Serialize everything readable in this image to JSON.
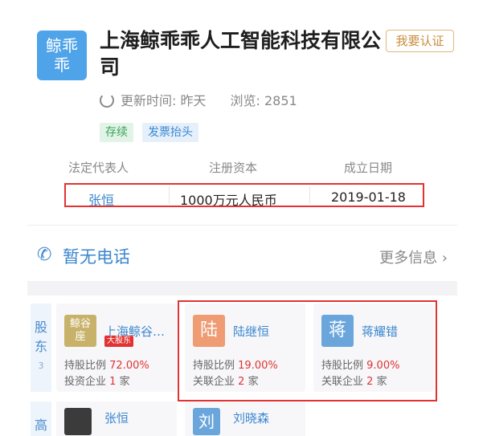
{
  "company": {
    "logo_line1": "鲸乖",
    "logo_line2": "乖",
    "name": "上海鲸乖乖人工智能科技有限公司",
    "claim_label": "我要认证",
    "updated": "更新时间: 昨天",
    "views": "浏览: 2851",
    "tags": [
      "存续",
      "发票抬头"
    ]
  },
  "info": {
    "headers": [
      "法定代表人",
      "注册资本",
      "成立日期"
    ],
    "values": [
      "张恒",
      "1000万元人民币",
      "2019-01-18"
    ]
  },
  "phone": {
    "text": "暂无电话",
    "more": "更多信息 ›"
  },
  "shareholders": {
    "section_label_1": "股",
    "section_label_2": "东",
    "count": "3",
    "list": [
      {
        "avatar": "鲸谷座",
        "avatar_line1": "鲸谷",
        "avatar_line2": "座",
        "name": "上海鲸谷…",
        "badge": "大股东",
        "ratio_label": "持股比例",
        "ratio": "72.00%",
        "second_label": "投资企业",
        "second_count": "1",
        "second_unit": "家",
        "color": "#c8b26a"
      },
      {
        "avatar": "陆",
        "name": "陆继恒",
        "ratio_label": "持股比例",
        "ratio": "19.00%",
        "second_label": "关联企业",
        "second_count": "2",
        "second_unit": "家",
        "color": "#ef9b73"
      },
      {
        "avatar": "蒋",
        "name": "蒋耀错",
        "ratio_label": "持股比例",
        "ratio": "9.00%",
        "second_label": "关联企业",
        "second_count": "2",
        "second_unit": "家",
        "color": "#6aa6dc"
      }
    ]
  },
  "executives": {
    "section_label": "高",
    "list": [
      {
        "name": "张恒"
      },
      {
        "avatar": "刘",
        "name": "刘晓森"
      }
    ]
  }
}
